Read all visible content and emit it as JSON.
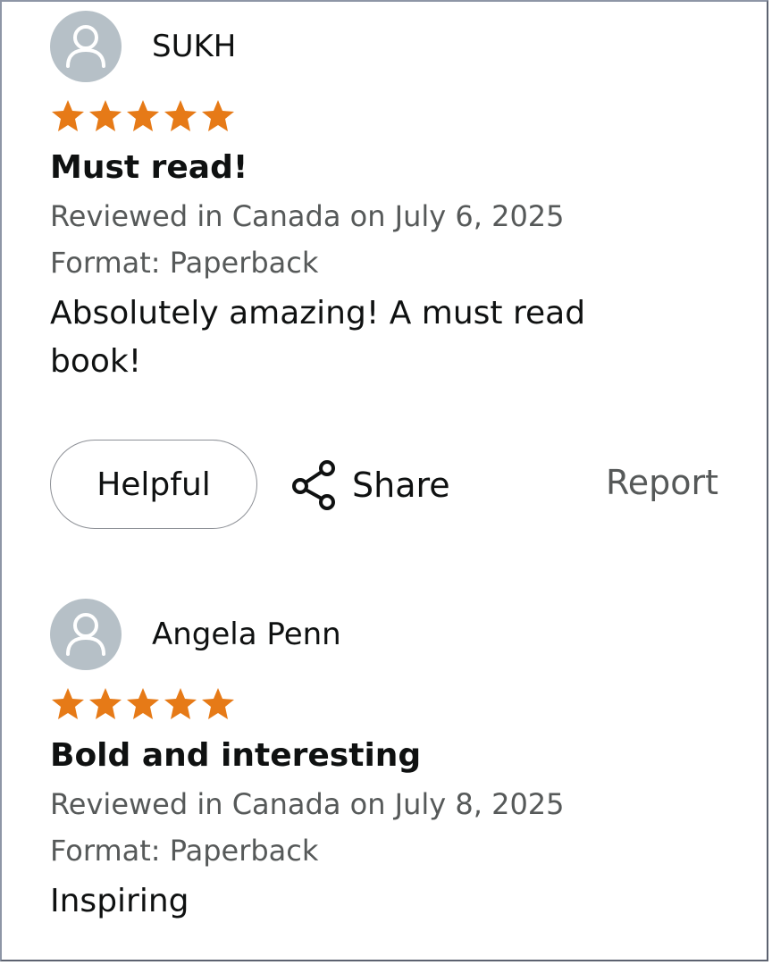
{
  "colors": {
    "star": "#e67a17",
    "avatar_bg": "#b6c0c7",
    "meta_text": "#565959"
  },
  "reviews": [
    {
      "reviewer": "SUKH",
      "rating": 5,
      "title": "Must read!",
      "reviewed": "Reviewed in Canada on July 6, 2025",
      "format": "Format: Paperback",
      "body": "Absolutely amazing! A must read book!"
    },
    {
      "reviewer": "Angela Penn",
      "rating": 5,
      "title": "Bold and interesting",
      "reviewed": "Reviewed in Canada on July 8, 2025",
      "format": "Format: Paperback",
      "body": "Inspiring"
    }
  ],
  "actions": {
    "helpful": "Helpful",
    "share": "Share",
    "report": "Report",
    "share_icon": "share-icon"
  }
}
